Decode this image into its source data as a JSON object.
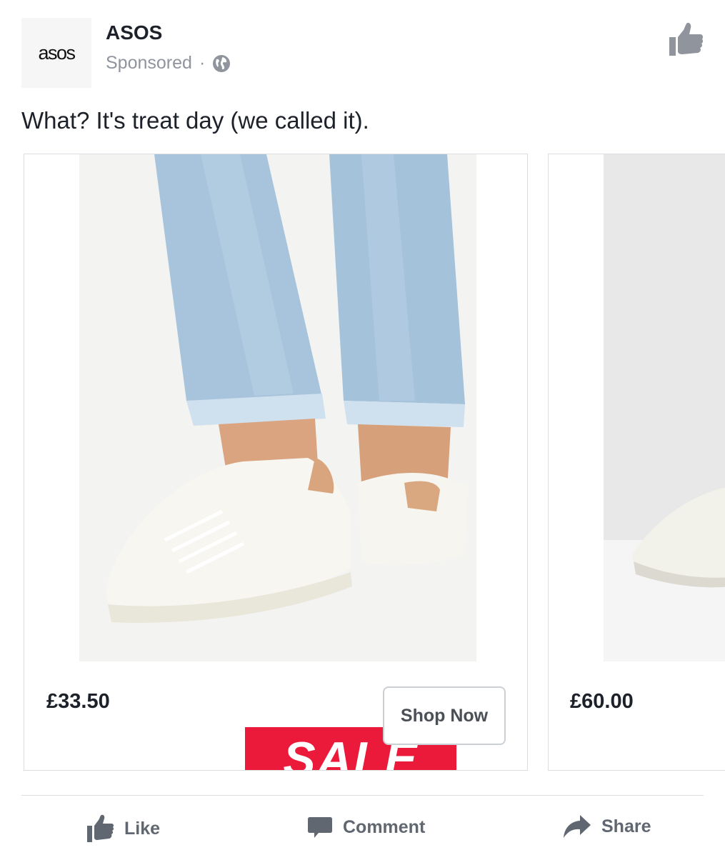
{
  "header": {
    "logo_text": "asos",
    "page_name": "ASOS",
    "sponsored_label": "Sponsored",
    "separator": "·",
    "audience_icon": "globe-icon",
    "like_page_icon": "thumbs-up-icon"
  },
  "post": {
    "text": "What? It's treat day (we called it)."
  },
  "carousel": {
    "cards": [
      {
        "price": "£33.50",
        "badge": "SALE",
        "cta": "Shop Now"
      },
      {
        "price": "£60.00"
      }
    ]
  },
  "actions": {
    "like": "Like",
    "comment": "Comment",
    "share": "Share"
  },
  "colors": {
    "text": "#1d2129",
    "muted": "#90949c",
    "action_gray": "#606770",
    "sale_red": "#ec1a3a",
    "border": "#dadde1"
  }
}
